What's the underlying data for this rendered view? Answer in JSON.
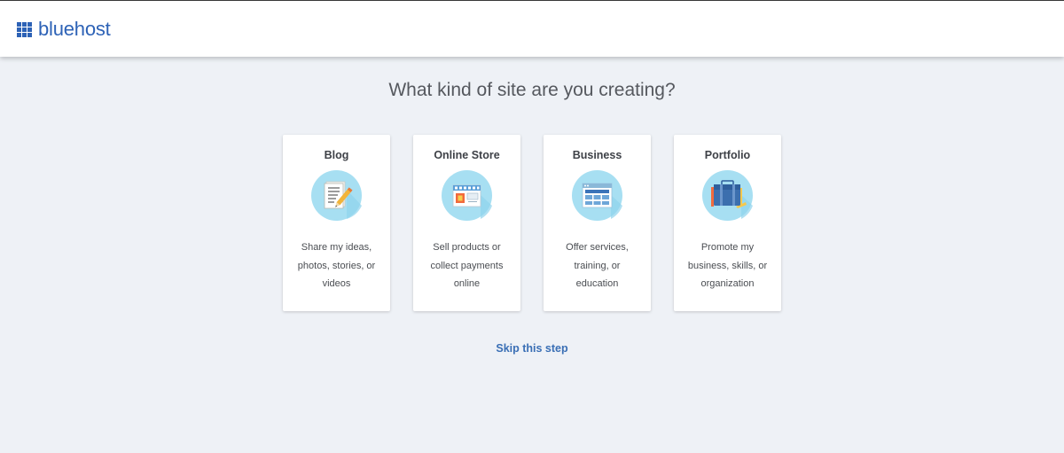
{
  "brand": {
    "name": "bluehost",
    "color": "#2d62b6"
  },
  "page": {
    "title": "What kind of site are you creating?",
    "skip_label": "Skip this step"
  },
  "cards": [
    {
      "title": "Blog",
      "description": "Share my ideas, photos, stories, or videos",
      "icon": "blog-document-pencil-icon"
    },
    {
      "title": "Online Store",
      "description": "Sell products or collect payments online",
      "icon": "storefront-icon"
    },
    {
      "title": "Business",
      "description": "Offer services, training, or education",
      "icon": "business-browser-window-icon"
    },
    {
      "title": "Portfolio",
      "description": "Promote my business, skills, or organization",
      "icon": "portfolio-briefcase-icon"
    }
  ]
}
